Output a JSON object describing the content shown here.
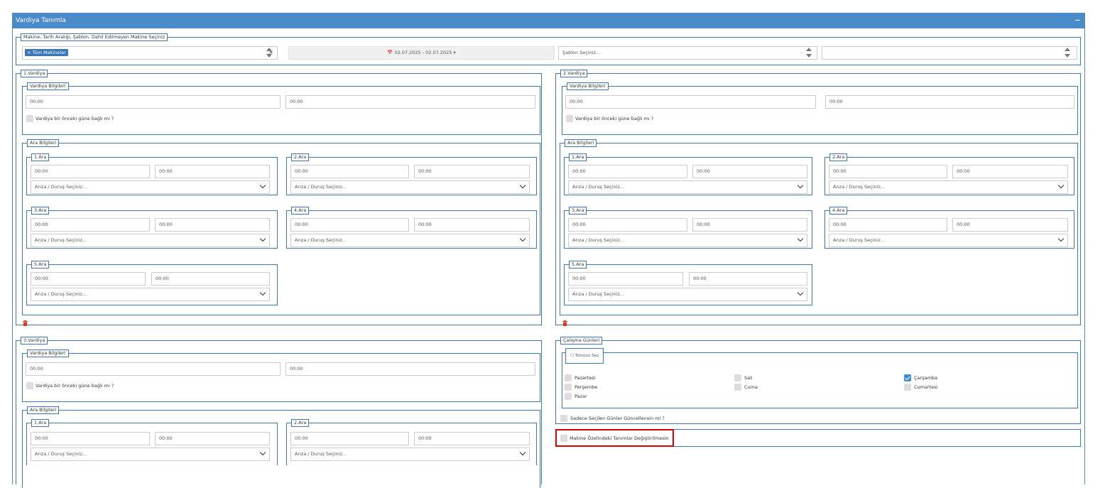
{
  "panel": {
    "title": "Vardiya Tanımla",
    "collapse": "−"
  },
  "filters": {
    "legend": "Makine, Tarih Aralığı, Şablon, Dahil Edilmeyen Makine Seçiniz",
    "machine_tag": "× Tüm Makineler",
    "machine_clear": "×",
    "date_range": "📅 02.07.2025 - 02.07.2025 ▾",
    "template_placeholder": "Şablon Seçiniz...",
    "template_clear": "-",
    "excluded_machines": ""
  },
  "labels": {
    "vardiya_bilgileri": "Vardiya Bilgileri",
    "ara_bilgileri": "Ara Bilgileri",
    "previous_day": "Vardiya bir önceki güne bağlı mı ?",
    "time_value": "00:00",
    "fault_placeholder": "Arıza / Duruş Seçiniz..."
  },
  "shifts": {
    "s1": {
      "title": "1.Vardiya"
    },
    "s2": {
      "title": "2.Vardiya"
    },
    "s3": {
      "title": "3.Vardiya"
    }
  },
  "breaks": [
    "1.Ara",
    "2.Ara",
    "3.Ara",
    "4.Ara",
    "5.Ara"
  ],
  "work_days": {
    "legend": "Çalışma Günleri",
    "select_all": "☐ Tümünü Seç",
    "days": [
      {
        "label": "Pazartesi",
        "checked": false
      },
      {
        "label": "Salı",
        "checked": false
      },
      {
        "label": "Çarşamba",
        "checked": true
      },
      {
        "label": "Perşembe",
        "checked": false
      },
      {
        "label": "Cuma",
        "checked": false
      },
      {
        "label": "Cumartesi",
        "checked": false
      },
      {
        "label": "Pazar",
        "checked": false
      }
    ],
    "only_selected_days": "Sadece Seçilen Günler Güncellensin mi ?"
  },
  "machine_specific": {
    "label": "Makine Özelindeki Tanımlar Değiştirilmesin",
    "checked": false
  },
  "colors": {
    "header": "#4a8bc9",
    "border": "#3a76b8",
    "checked": "#3b8fd9",
    "highlight": "#e10000"
  },
  "icons": {
    "delete": "trash-icon",
    "dropdown": "chevron-down-icon",
    "calendar": "calendar-icon"
  }
}
